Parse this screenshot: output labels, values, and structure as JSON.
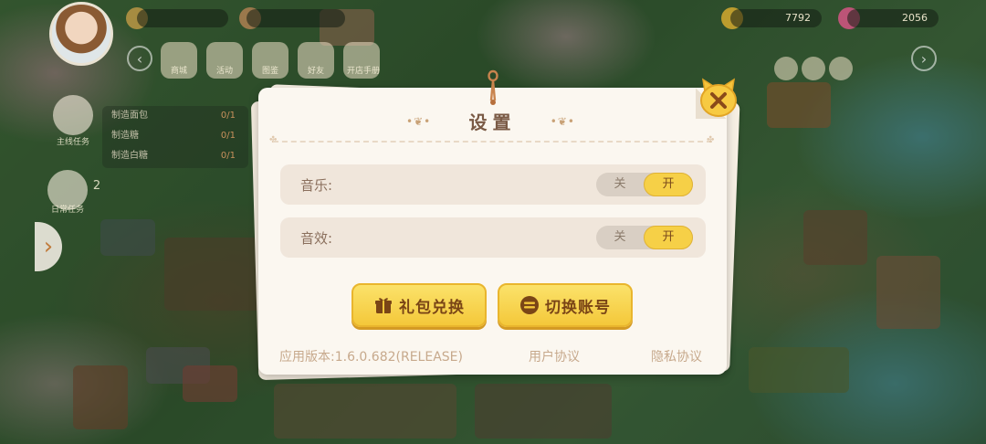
{
  "hud": {
    "coins": "7792",
    "gems": "2056",
    "menu_labels": [
      "商城",
      "活动",
      "图鉴",
      "好友",
      "开店手册"
    ],
    "tasks": [
      {
        "name": "制造面包",
        "count": "0/1"
      },
      {
        "name": "制造糖",
        "count": "0/1"
      },
      {
        "name": "制造白糖",
        "count": "0/1"
      }
    ],
    "task_button": "主线任务",
    "daily_button": "日常任务",
    "task_badge": "2"
  },
  "dialog": {
    "title": "设置",
    "settings": [
      {
        "label": "音乐:",
        "off": "关",
        "on": "开",
        "state": "on"
      },
      {
        "label": "音效:",
        "off": "关",
        "on": "开",
        "state": "on"
      }
    ],
    "buttons": {
      "gift": "礼包兑换",
      "switch_account": "切换账号"
    },
    "footer": {
      "version": "应用版本:1.6.0.682(RELEASE)",
      "user_agreement": "用户协议",
      "privacy": "隐私协议"
    }
  },
  "colors": {
    "accent_yellow": "#f6d047",
    "title_brown": "#7a5a45",
    "panel_bg": "#fbf7f0",
    "row_bg": "#f0e6db"
  }
}
